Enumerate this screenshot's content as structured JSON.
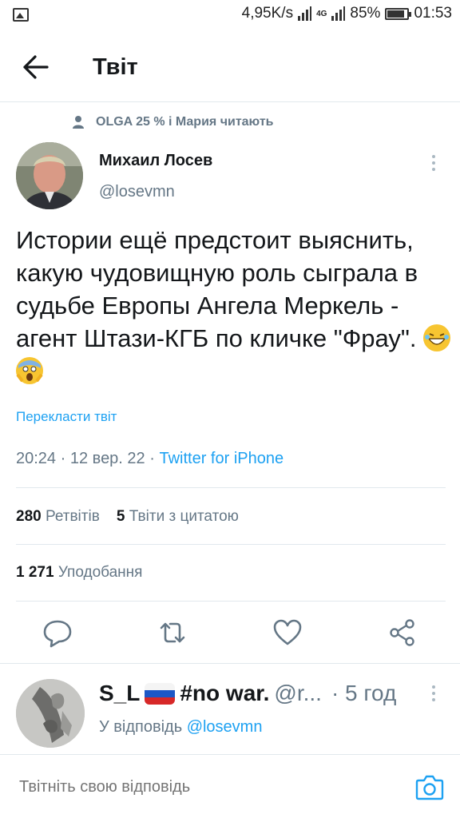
{
  "status_bar": {
    "network_speed": "4,95K/s",
    "network_type": "4G",
    "battery": "85%",
    "battery_level": 0.85,
    "time": "01:53"
  },
  "header": {
    "title": "Твіт"
  },
  "tweet": {
    "social_context": "OLGA 25 % і Мария читають",
    "author_name": "Михаил Лосев",
    "author_handle": "@losevmn",
    "text": "Истории ещё предстоит выяснить, какую чудовищную роль сыграла в судьбе Европы Ангела Меркель - агент Штази-КГБ по кличке  \"Фрау\".",
    "translate_label": "Перекласти твіт",
    "time": "20:24",
    "date": "12 вер. 22",
    "separator": "·",
    "source": "Twitter for iPhone",
    "retweets_count": "280",
    "retweets_label": "Ретвітів",
    "quotes_count": "5",
    "quotes_label": "Твіти з цитатою",
    "likes_count": "1 271",
    "likes_label": "Уподобання"
  },
  "actions": [
    "reply-icon",
    "retweet-icon",
    "like-icon",
    "share-icon"
  ],
  "reply": {
    "name_part1": "S_L",
    "name_part2": "#no war.",
    "handle": "@r...",
    "time": "· 5 год",
    "reply_to_label": "У відповідь",
    "reply_to_handle": "@losevmn"
  },
  "composer": {
    "placeholder": "Твітніть свою відповідь"
  },
  "colors": {
    "accent": "#1da1f2",
    "secondary_text": "#657786",
    "divider": "#e1e8ed"
  }
}
